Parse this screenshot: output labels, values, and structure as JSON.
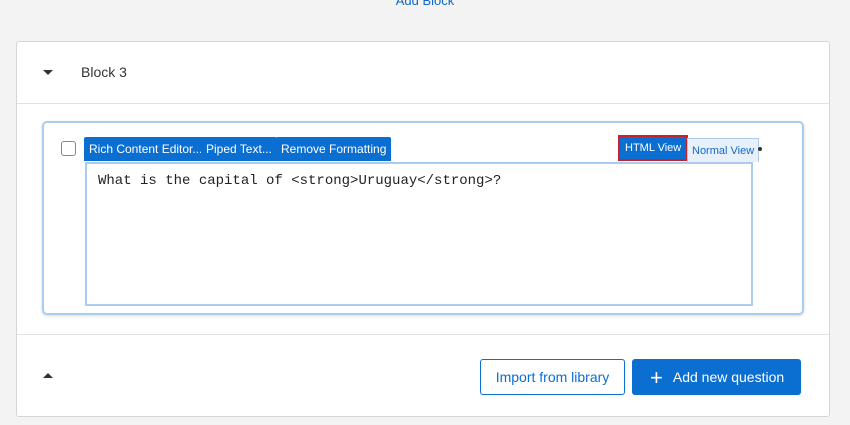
{
  "top": {
    "add_block": "Add Block"
  },
  "block": {
    "title": "Block 3"
  },
  "toolbar": {
    "rich": "Rich Content Editor...",
    "piped": "Piped Text...",
    "remove": "Remove Formatting",
    "html_view": "HTML View",
    "normal_view": "Normal View"
  },
  "editor": {
    "value": "What is the capital of <strong>Uruguay</strong>?"
  },
  "footer": {
    "import": "Import from library",
    "add": "Add new question",
    "plus": "+"
  }
}
